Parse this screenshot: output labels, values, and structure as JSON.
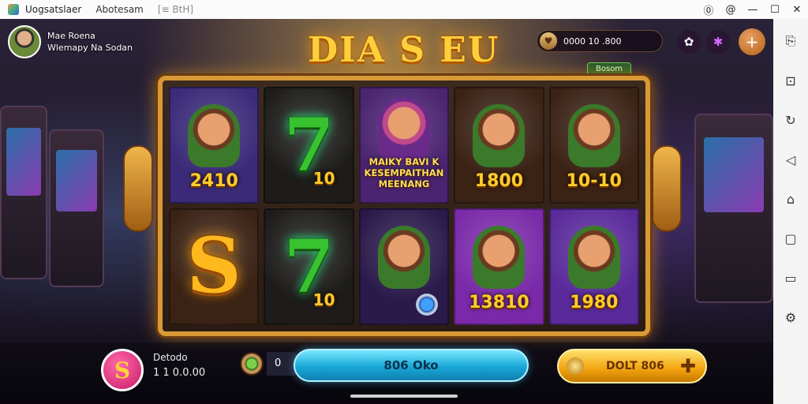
{
  "window": {
    "title": "Uogsatslaer",
    "menu1": "Abotesam",
    "menu2": "[≡ BtH]",
    "controls": {
      "help": "⓪",
      "account": "@",
      "minimize": "—",
      "maximize": "☐",
      "close": "✕"
    }
  },
  "player": {
    "name": "Mae Roena",
    "subtitle": "Wlemapy Na Sodan"
  },
  "game": {
    "logo": "DIA S EU",
    "balance": "0000 10 .800",
    "badge": "Bosom",
    "reels": [
      {
        "type": "portrait",
        "value": "2410",
        "bg": "#3a2a78"
      },
      {
        "type": "seven",
        "value": "10",
        "bg": "#1d1c1a"
      },
      {
        "type": "text",
        "lines": [
          "MAIKY BAVI K",
          "KESEMPAITHAN",
          "MEENANG"
        ],
        "bg": "#4a2470"
      },
      {
        "type": "portrait",
        "value": "1800",
        "bg": "#3a2214"
      },
      {
        "type": "portrait",
        "value": "10-10",
        "bg": "#3a2214"
      },
      {
        "type": "s",
        "value": "",
        "bg": "#3a2214"
      },
      {
        "type": "seven",
        "value": "10",
        "bg": "#1d1c1a"
      },
      {
        "type": "portrait-coin",
        "value": "",
        "bg": "#2a1a4a"
      },
      {
        "type": "portrait",
        "value": "13810",
        "bg": "#7a2aa8"
      },
      {
        "type": "portrait",
        "value": "1980",
        "bg": "#5a2a9a"
      }
    ],
    "bet_label": "Detodo",
    "bet_value": "1 1 0.0.00",
    "coin_value": "0",
    "spin_label": "806 Oko",
    "auto_label": "DOLT 806"
  },
  "colors": {
    "accent": "#ffcc2a",
    "spin": "#18a8d8",
    "auto": "#f2a20e",
    "frame": "#d89a36"
  }
}
